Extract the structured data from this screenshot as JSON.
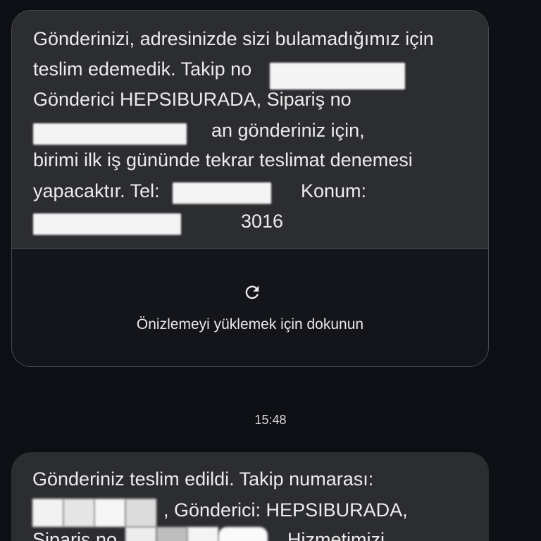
{
  "message1": {
    "lines": [
      "Gönderinizi, adresinizde sizi bulamadığımız için",
      "teslim edemedik. Takip no",
      "Gönderici HEPSIBURADA, Sipariş no",
      "an gönderiniz için,",
      "birimi ilk iş gününde tekrar teslimat denemesi",
      "yapacaktır. Tel:",
      "Konum:",
      "3016"
    ]
  },
  "preview": {
    "icon": "refresh-icon",
    "label": "Önizlemeyi yüklemek için dokunun"
  },
  "timestamp": "15:48",
  "message2": {
    "lines": [
      "Gönderiniz teslim edildi. Takip numarası:",
      ", Gönderici: HEPSIBURADA,",
      "Sipariş no",
      "Hizmetimizi"
    ]
  },
  "colors": {
    "background": "#0d0f14",
    "bubble": "#2c2d31",
    "preview_bg": "#13151b",
    "border": "#4a4c52",
    "text": "#ececec"
  }
}
